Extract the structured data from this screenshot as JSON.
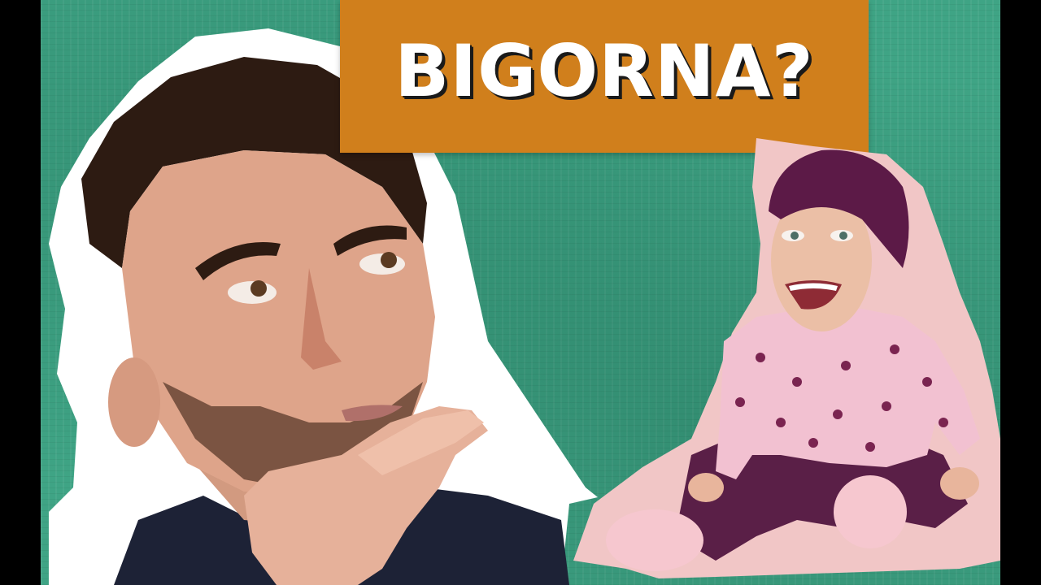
{
  "thumbnail": {
    "title": "BIGORNA?",
    "colors": {
      "background": "#3fa485",
      "title_box": "#d07f1c",
      "title_text": "#ffffff",
      "cutout_border": "#ffffff",
      "baby_cutout_border": "#f1c6c6"
    },
    "figures": [
      {
        "name": "thinking-man-cutout"
      },
      {
        "name": "baby-outfit-woman-cutout"
      }
    ]
  }
}
